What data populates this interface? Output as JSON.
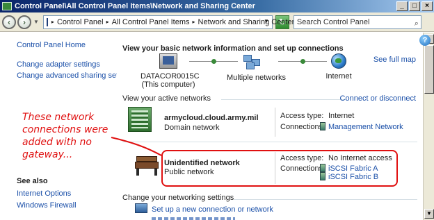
{
  "window": {
    "title": "Control Panel\\All Control Panel Items\\Network and Sharing Center",
    "min_glyph": "_",
    "max_glyph": "□",
    "close_glyph": "×"
  },
  "address": {
    "crumbs": [
      "Control Panel",
      "All Control Panel Items",
      "Network and Sharing Center"
    ],
    "separator": "▸",
    "search_placeholder": "Search Control Panel"
  },
  "left": {
    "home": "Control Panel Home",
    "links": [
      "Change adapter settings",
      "Change advanced sharing settings"
    ],
    "see_also_title": "See also",
    "see_also": [
      "Internet Options",
      "Windows Firewall"
    ]
  },
  "main": {
    "title": "View your basic network information and set up connections",
    "see_full_map": "See full map",
    "map": {
      "computer_name": "DATACOR0015C",
      "computer_sub": "(This computer)",
      "middle": "Multiple networks",
      "right": "Internet"
    },
    "active_header": "View your active networks",
    "connect_link": "Connect or disconnect",
    "networks": [
      {
        "name": "armycloud.cloud.army.mil",
        "type": "Domain network",
        "access_label": "Access type:",
        "access_value": "Internet",
        "connections_label": "Connections:",
        "connections": [
          "Management Network"
        ]
      },
      {
        "name": "Unidentified network",
        "type": "Public network",
        "access_label": "Access type:",
        "access_value": "No Internet access",
        "connections_label": "Connections:",
        "connections": [
          "iSCSI Fabric A",
          "iSCSI Fabric B"
        ]
      }
    ],
    "change_header": "Change your networking settings",
    "setup_link": "Set up a new connection or network"
  },
  "annotation": {
    "text": "These network connections were added with no gateway...",
    "color": "#e01010"
  },
  "colors": {
    "link": "#1a4fa8",
    "titlebar": "#0a246a"
  }
}
